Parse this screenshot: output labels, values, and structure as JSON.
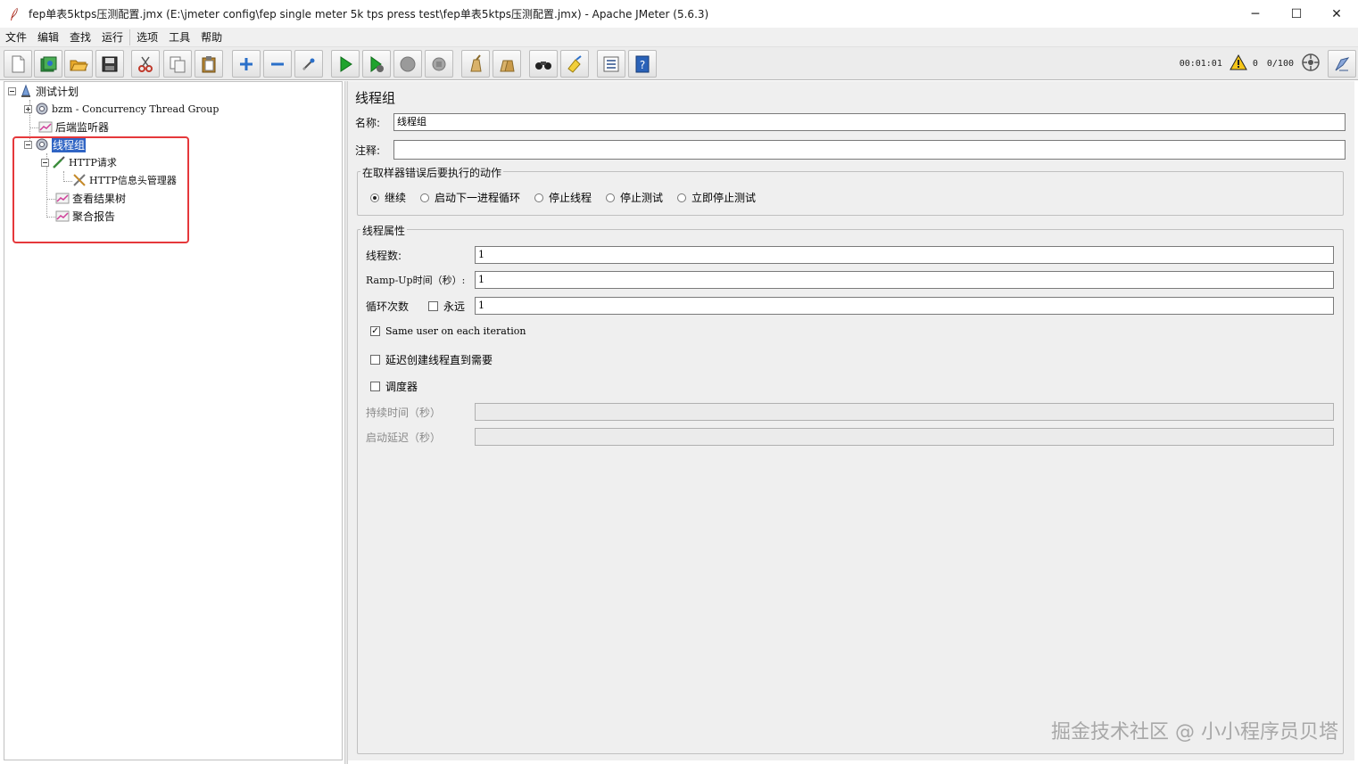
{
  "window": {
    "title": "fep单表5ktps压测配置.jmx (E:\\jmeter config\\fep single meter 5k tps press test\\fep单表5ktps压测配置.jmx) - Apache JMeter (5.6.3)",
    "minimize": "─",
    "maximize": "☐",
    "close": "✕"
  },
  "menu": [
    "文件",
    "编辑",
    "查找",
    "运行",
    "选项",
    "工具",
    "帮助"
  ],
  "toolbar": {
    "buttons": [
      "new-icon",
      "templates-icon",
      "open-icon",
      "save-icon",
      "cut-icon",
      "copy-icon",
      "paste-icon",
      "expand-icon",
      "collapse-icon",
      "toggle-icon",
      "start-icon",
      "start-no-pause-icon",
      "stop-icon",
      "shutdown-icon",
      "clear-icon",
      "clear-all-icon",
      "search-icon",
      "reset-search-icon",
      "function-helper-icon",
      "help-icon"
    ],
    "status": {
      "elapsed": "00:01:01",
      "warnings": "0",
      "threads": "0/100"
    }
  },
  "tree": {
    "test_plan": "测试计划",
    "bzm_group": "bzm - Concurrency Thread Group",
    "backend_listener": "后端监听器",
    "thread_group": "线程组",
    "http_request": "HTTP请求",
    "header_manager": "HTTP信息头管理器",
    "results_tree": "查看结果树",
    "aggregate_report": "聚合报告"
  },
  "config": {
    "heading": "线程组",
    "name_label": "名称:",
    "name_value": "线程组",
    "comment_label": "注释:",
    "comment_value": "",
    "error_action": {
      "legend": "在取样器错误后要执行的动作",
      "options": [
        "继续",
        "启动下一进程循环",
        "停止线程",
        "停止测试",
        "立即停止测试"
      ],
      "selected": "继续"
    },
    "properties": {
      "legend": "线程属性",
      "threads_label": "线程数:",
      "threads_value": "1",
      "rampup_label": "Ramp-Up时间（秒）:",
      "rampup_value": "1",
      "loop_label": "循环次数",
      "forever_label": "永远",
      "forever_checked": false,
      "loop_value": "1",
      "same_user_label": "Same user on each iteration",
      "same_user_checked": true,
      "delay_label": "延迟创建线程直到需要",
      "delay_checked": false,
      "scheduler_label": "调度器",
      "scheduler_checked": false,
      "duration_label": "持续时间（秒）",
      "duration_value": "",
      "startup_delay_label": "启动延迟（秒）",
      "startup_delay_value": ""
    }
  },
  "watermark": "掘金技术社区 @ 小小程序员贝塔"
}
